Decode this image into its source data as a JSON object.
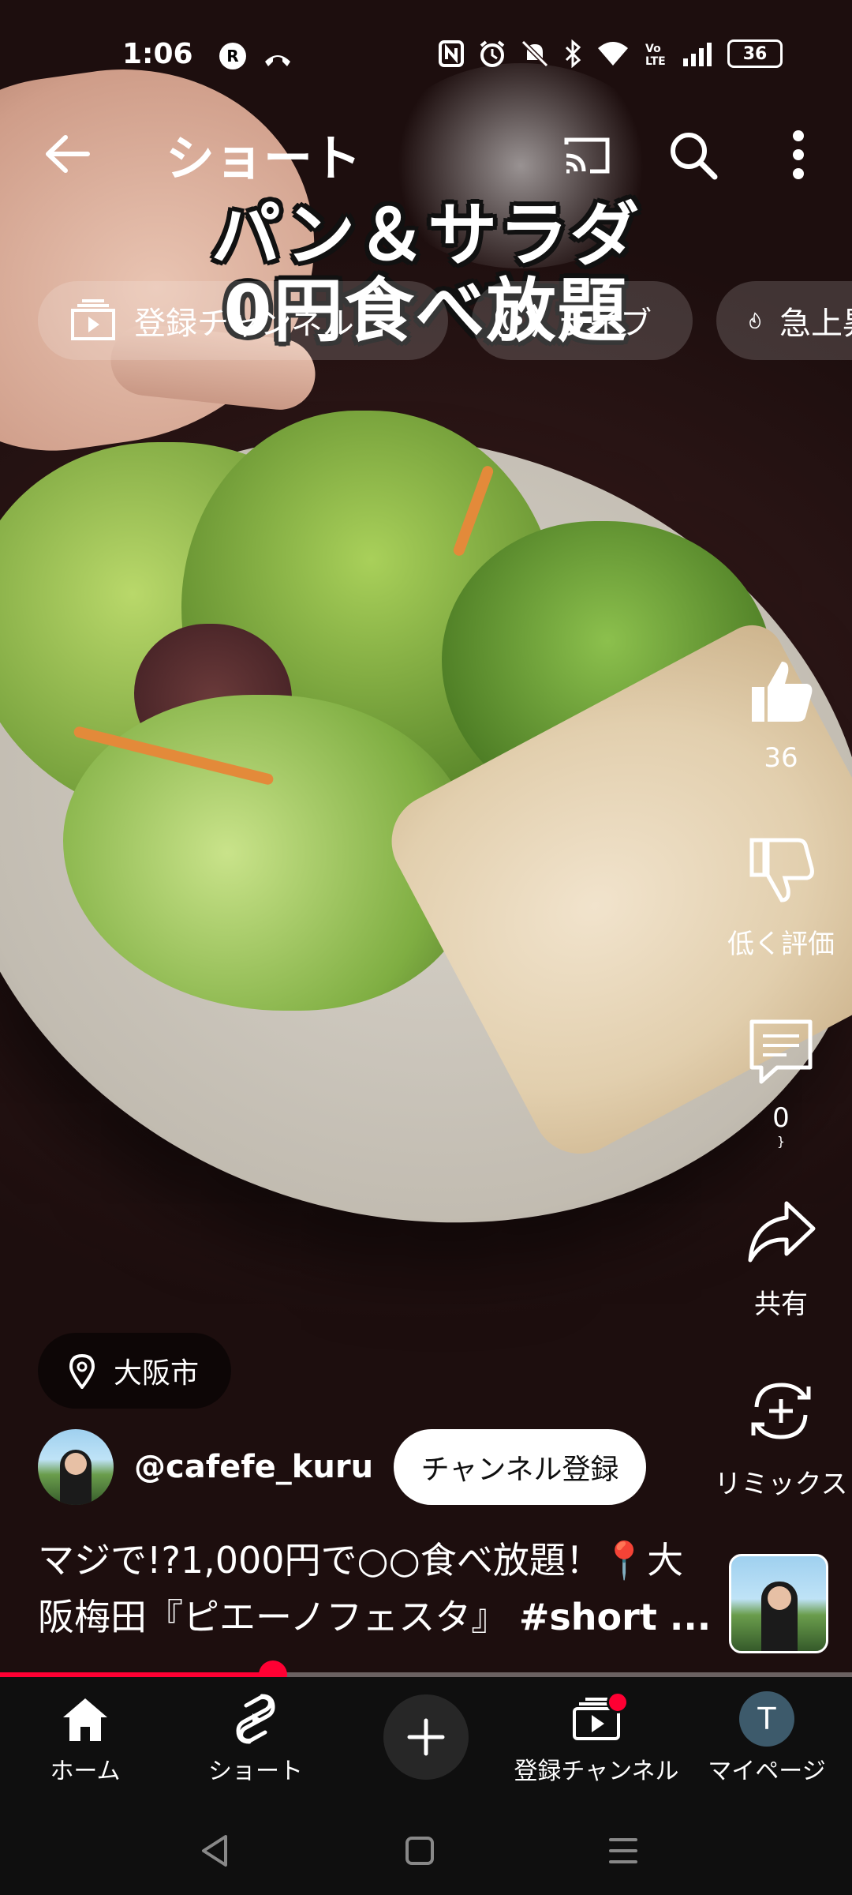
{
  "status_bar": {
    "time": "1:06",
    "battery": "36"
  },
  "top_bar": {
    "title": "ショート"
  },
  "chips": [
    {
      "label": "登録チャンネル"
    },
    {
      "label": "ライブ"
    },
    {
      "label": "急上昇"
    }
  ],
  "video": {
    "caption_line1": "パン＆サラダ",
    "caption_line2": "0円食べ放題",
    "progress_fraction": 0.32
  },
  "actions": {
    "like_count": "36",
    "dislike_label": "低く評価",
    "comment_count": "0",
    "share_label": "共有",
    "remix_label": "リミックス"
  },
  "location": {
    "label": "大阪市"
  },
  "channel": {
    "handle": "@cafefe_kuru",
    "subscribe_label": "チャンネル登録"
  },
  "title": {
    "text": "マジで!?1,000円で○○食べ放題！📍大阪梅田『ピエーノフェスタ』",
    "hashtag": "#short ..."
  },
  "bottom_nav": {
    "home": "ホーム",
    "shorts": "ショート",
    "subscriptions": "登録チャンネル",
    "profile": "マイページ",
    "profile_initial": "T"
  },
  "colors": {
    "accent": "#ff0033",
    "nav_bg": "#0f0f0f"
  }
}
